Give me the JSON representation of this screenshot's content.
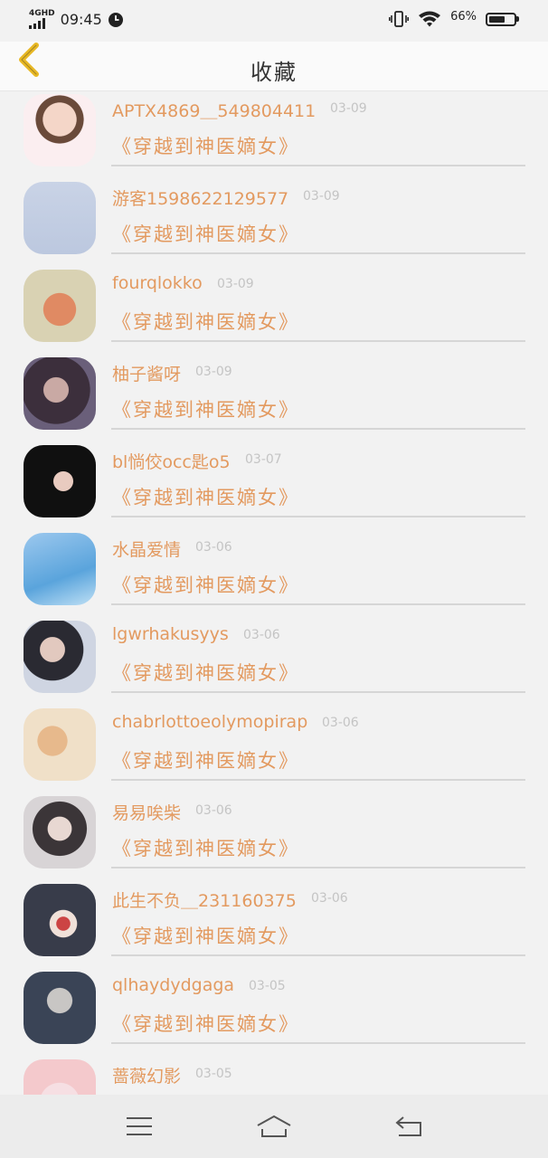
{
  "status_bar": {
    "network": "4GHD",
    "time": "09:45",
    "battery_percent": "66%",
    "battery_level": 0.66
  },
  "header": {
    "title": "收藏",
    "back_icon": "chevron-left-icon",
    "accent_color": "#e8b824"
  },
  "favorites": [
    {
      "username": "APTX4869＿549804411",
      "date": "03-09",
      "book": "《穿越到神医嫡女》"
    },
    {
      "username": "游客1598622129577",
      "date": "03-09",
      "book": "《穿越到神医嫡女》"
    },
    {
      "username": "fourqlokko",
      "date": "03-09",
      "book": "《穿越到神医嫡女》"
    },
    {
      "username": "柚子酱呀",
      "date": "03-09",
      "book": "《穿越到神医嫡女》"
    },
    {
      "username": "bl惝佼occ匙o5",
      "date": "03-07",
      "book": "《穿越到神医嫡女》"
    },
    {
      "username": "水晶爱情",
      "date": "03-06",
      "book": "《穿越到神医嫡女》"
    },
    {
      "username": "lgwrhakusyys",
      "date": "03-06",
      "book": "《穿越到神医嫡女》"
    },
    {
      "username": "chabrlottoeolymopirap",
      "date": "03-06",
      "book": "《穿越到神医嫡女》"
    },
    {
      "username": "易易唉柴",
      "date": "03-06",
      "book": "《穿越到神医嫡女》"
    },
    {
      "username": "此生不负＿231160375",
      "date": "03-06",
      "book": "《穿越到神医嫡女》"
    },
    {
      "username": "qlhaydydgaga",
      "date": "03-05",
      "book": "《穿越到神医嫡女》"
    },
    {
      "username": "蔷薇幻影",
      "date": "03-05",
      "book": ""
    }
  ],
  "nav_bar": {
    "menu_icon": "menu-icon",
    "home_icon": "home-icon",
    "back_icon": "back-arrow-icon"
  },
  "colors": {
    "username": "#e39a60",
    "date": "#c4c4c4",
    "divider": "#d6d6d6"
  }
}
